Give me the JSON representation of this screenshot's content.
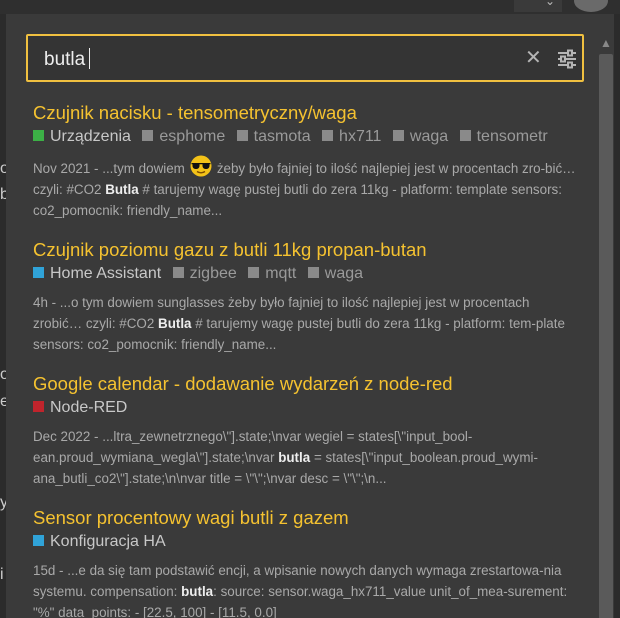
{
  "search": {
    "query": "butla"
  },
  "colors": {
    "accent": "#f0c040",
    "title": "#f5c230"
  },
  "background": {
    "letters": [
      "o",
      "b",
      "o",
      "e",
      "y",
      "i"
    ]
  },
  "results": [
    {
      "title": "Czujnik nacisku - tensometryczny/waga",
      "category": "Urządzenia",
      "category_color": "#3cb046",
      "tags": [
        "esphome",
        "tasmota",
        "hx711",
        "waga",
        "tensometr"
      ],
      "excerpt": {
        "before": "Nov 2021 - ...tym dowiem",
        "emoji": "sunglasses-emoji",
        "after": "żeby było fajniej to ilość najlepiej jest w procentach zro-bić… czyli: #CO2",
        "highlight": "Butla",
        "rest": "# tarujemy wagę pustej butli do zera 11kg - platform: template sensors: co2_pomocnik: friendly_name..."
      }
    },
    {
      "title": "Czujnik poziomu gazu z butli 11kg propan-butan",
      "category": "Home Assistant",
      "category_color": "#30a3d8",
      "tags": [
        "zigbee",
        "mqtt",
        "waga"
      ],
      "excerpt": {
        "before": "4h - ...o tym dowiem sunglasses żeby było fajniej to ilość najlepiej jest w procentach zrobić… czyli: #CO2",
        "highlight": "Butla",
        "after": "# tarujemy wagę pustej butli do zera 11kg - platform: tem-plate sensors: co2_pomocnik: friendly_name..."
      }
    },
    {
      "title": "Google calendar - dodawanie wydarzeń z node-red",
      "category": "Node-RED",
      "category_color": "#c0242c",
      "tags": [],
      "excerpt": {
        "before": "Dec 2022 - ...ltra_zewnetrznego\\\"].state;\\nvar wegiel = states[\\\"input_bool-ean.proud_wymiana_wegla\\\"].state;\\nvar",
        "highlight": "butla",
        "after": "= states[\\\"input_boolean.proud_wymi-ana_butli_co2\\\"].state;\\n\\nvar title = \\\"\\\";\\nvar desc = \\\"\\\";\\n..."
      }
    },
    {
      "title": "Sensor procentowy wagi butli z gazem",
      "category": "Konfiguracja HA",
      "category_color": "#30a3d8",
      "tags": [],
      "excerpt": {
        "before": "15d - ...e da się tam podstawić encji, a wpisanie nowych danych wymaga zrestartowa-nia systemu. compensation:",
        "highlight": "butla",
        "after": ": source: sensor.waga_hx711_value unit_of_mea-surement: \"%\" data_points: - [22.5, 100] - [11.5, 0.0]"
      }
    }
  ]
}
